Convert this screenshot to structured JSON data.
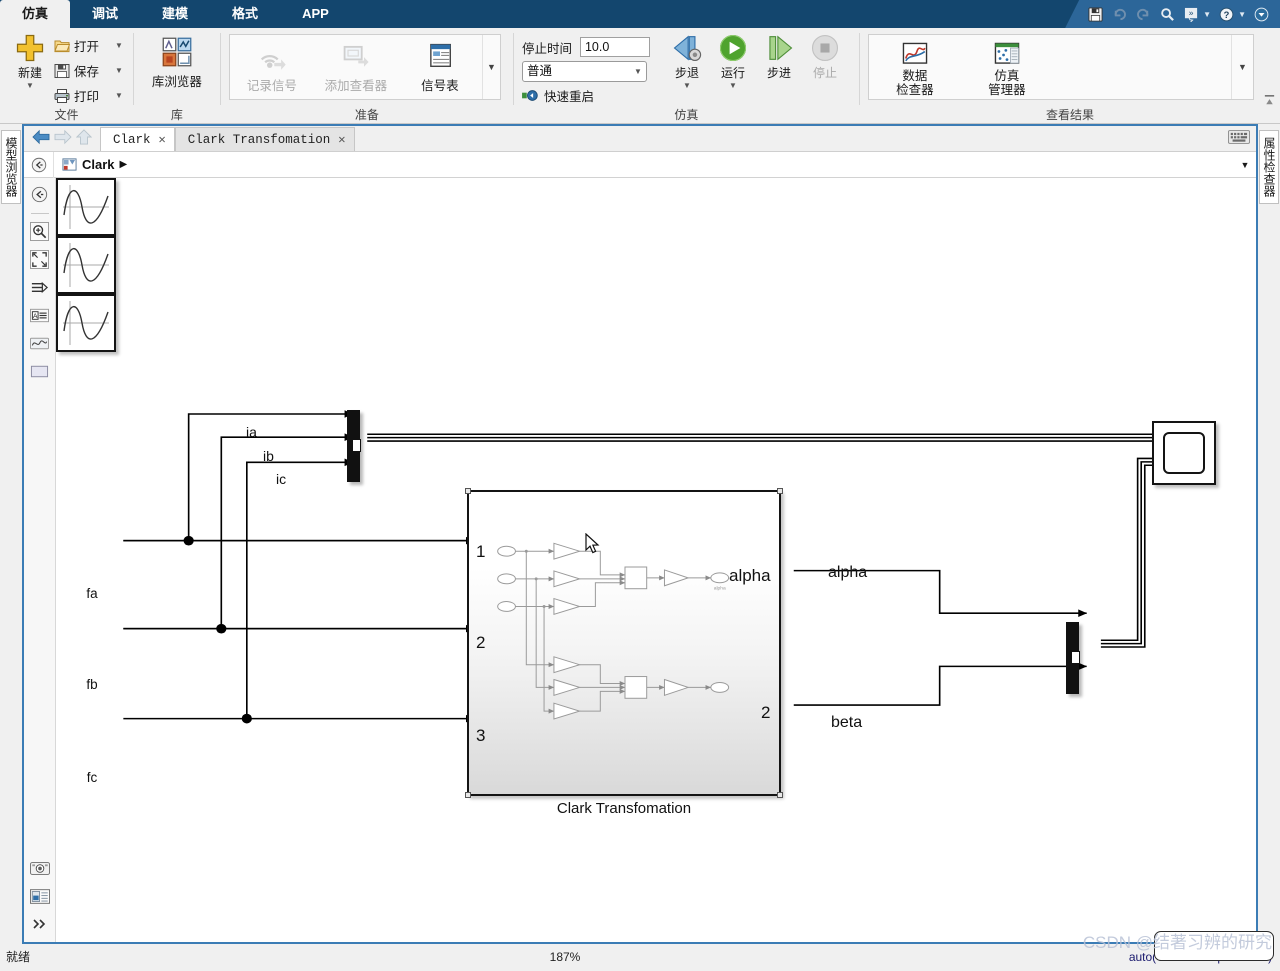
{
  "ribbon": {
    "tabs": [
      {
        "label": "仿真",
        "active": true
      },
      {
        "label": "调试",
        "active": false
      },
      {
        "label": "建模",
        "active": false
      },
      {
        "label": "格式",
        "active": false
      },
      {
        "label": "APP",
        "active": false
      }
    ],
    "quick_access": [
      {
        "name": "save-icon",
        "glyph": "💾"
      },
      {
        "name": "undo-icon",
        "glyph": "↶"
      },
      {
        "name": "redo-icon",
        "glyph": "↷"
      },
      {
        "name": "search-icon",
        "glyph": "🔍"
      },
      {
        "name": "favorites-icon",
        "glyph": "»"
      },
      {
        "name": "help-icon",
        "glyph": "?"
      },
      {
        "name": "customize-icon",
        "glyph": "▼"
      }
    ],
    "groups": {
      "file": {
        "title": "文件",
        "new_label": "新建",
        "items": [
          {
            "label": "打开",
            "icon": "folder-open-icon"
          },
          {
            "label": "保存",
            "icon": "floppy-disk-icon"
          },
          {
            "label": "打印",
            "icon": "printer-icon"
          }
        ]
      },
      "library": {
        "title": "库",
        "browser_label": "库浏览器"
      },
      "prepare": {
        "title": "准备",
        "items": [
          {
            "label": "记录信号",
            "icon": "log-signal-icon",
            "disabled": true
          },
          {
            "label": "添加查看器",
            "icon": "add-viewer-icon",
            "disabled": true
          },
          {
            "label": "信号表",
            "icon": "signal-table-icon",
            "disabled": false
          }
        ]
      },
      "simulate": {
        "title": "仿真",
        "stop_time_label": "停止时间",
        "stop_time_value": "10.0",
        "mode_value": "普通",
        "fast_restart_label": "快速重启",
        "buttons": [
          {
            "label": "步退",
            "icon": "step-back-icon",
            "has_caret": true,
            "disabled": false
          },
          {
            "label": "运行",
            "icon": "run-icon",
            "has_caret": true,
            "disabled": false
          },
          {
            "label": "步进",
            "icon": "step-forward-icon",
            "has_caret": false,
            "disabled": false
          },
          {
            "label": "停止",
            "icon": "stop-icon",
            "has_caret": false,
            "disabled": true
          }
        ]
      },
      "results": {
        "title": "查看结果",
        "items": [
          {
            "line1": "数据",
            "line2": "检查器",
            "icon": "data-inspector-icon"
          },
          {
            "line1": "仿真",
            "line2": "管理器",
            "icon": "simulation-manager-icon"
          }
        ]
      }
    }
  },
  "docks": {
    "left_label": "模型浏览器",
    "right_label": "属性检查器"
  },
  "editor": {
    "tabs": [
      {
        "label": "Clark",
        "active": true
      },
      {
        "label": "Clark Transfomation",
        "active": false
      }
    ],
    "breadcrumb": {
      "root": "Clark",
      "separator": "▶"
    }
  },
  "palette": {
    "tools": [
      {
        "name": "navigate-up-icon"
      },
      {
        "name": "zoom-in-icon"
      },
      {
        "name": "fit-to-view-icon"
      },
      {
        "name": "signal-routing-icon"
      },
      {
        "name": "annotation-icon"
      },
      {
        "name": "scope-preview-icon"
      },
      {
        "name": "subsystem-icon"
      },
      {
        "name": "camera-icon"
      },
      {
        "name": "layout-icon"
      },
      {
        "name": "more-tools-icon"
      }
    ]
  },
  "diagram": {
    "sources": [
      {
        "label": "fa",
        "icon": "sine-wave-icon"
      },
      {
        "label": "fb",
        "icon": "sine-wave-icon"
      },
      {
        "label": "fc",
        "icon": "sine-wave-icon"
      }
    ],
    "signal_labels": [
      "ia",
      "ib",
      "ic"
    ],
    "subsystem": {
      "caption": "Clark Transfomation",
      "input_ports": [
        "1",
        "2",
        "3"
      ],
      "output_port_labels": [
        "alpha",
        "2"
      ],
      "inner_out_label": "alpha"
    },
    "output_signal_labels": [
      "alpha",
      "beta"
    ],
    "blocks": {
      "mux_top": "mux-block",
      "mux_bottom": "mux-block",
      "scope": "scope-block"
    }
  },
  "statusbar": {
    "ready": "就绪",
    "zoom": "187%",
    "solver": "auto(VariableStepDiscrete)"
  },
  "watermark": "CSDN @结著习辨的研究",
  "colors": {
    "ribbon_blue": "#13466e",
    "quick_access_blue": "#2c6699",
    "frame_blue": "#3b7cb5",
    "chrome_gray": "#f0f0f0",
    "solver_text": "#1a1a6e"
  }
}
